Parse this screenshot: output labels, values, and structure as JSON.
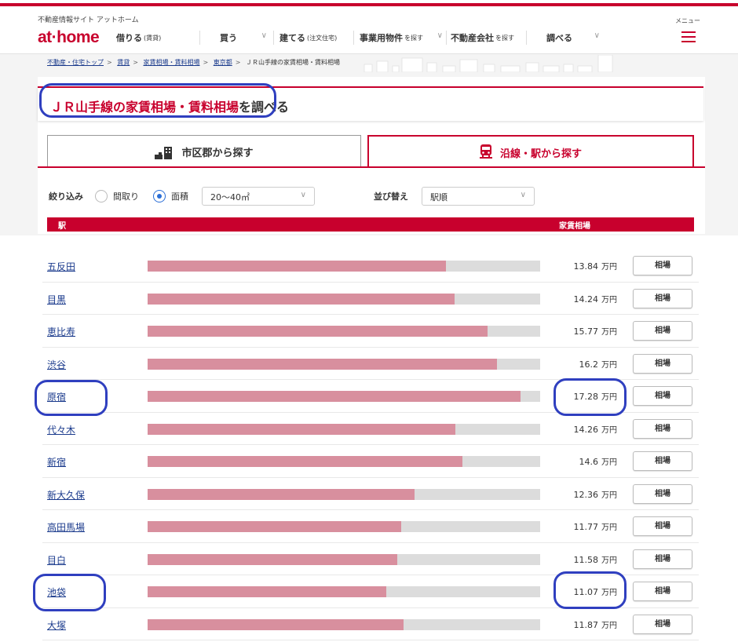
{
  "header": {
    "site_name": "不動産情報サイト アットホーム",
    "logo": "at·home",
    "menu_label": "メニュー",
    "nav": [
      {
        "label": "借りる",
        "sub": "(賃貸)",
        "chevron": ""
      },
      {
        "label": "買う",
        "sub": "",
        "chevron": "∨"
      },
      {
        "label": "建てる",
        "sub": "(注文住宅)",
        "chevron": ""
      },
      {
        "label": "事業用物件",
        "sub": "を探す",
        "chevron": "∨"
      },
      {
        "label": "不動産会社",
        "sub": "を探す",
        "chevron": ""
      },
      {
        "label": "調べる",
        "sub": "",
        "chevron": "∨"
      }
    ]
  },
  "breadcrumb": {
    "items": [
      "不動産・住宅トップ",
      "賃貸",
      "家賃相場・賃料相場",
      "東京都"
    ],
    "current": "ＪＲ山手線の家賃相場・賃料相場",
    "separator": ">"
  },
  "page": {
    "title_highlight": "ＪＲ山手線の家賃相場・賃料相場",
    "title_rest": "を調べる"
  },
  "tabs": [
    {
      "label": "市区郡から探す",
      "active": false
    },
    {
      "label": "沿線・駅から探す",
      "active": true
    }
  ],
  "filter": {
    "narrow_label": "絞り込み",
    "option_layout": "間取り",
    "option_area": "面積",
    "area_value": "20〜40㎡",
    "sort_label": "並び替え",
    "sort_value": "駅順",
    "chevron": "∨"
  },
  "table": {
    "col_station": "駅",
    "col_rent": "家賃相場",
    "button_label": "相場",
    "unit": "万円",
    "bar_max": 18.2,
    "rows": [
      {
        "station": "五反田",
        "rent": "13.84",
        "value": 13.84
      },
      {
        "station": "目黒",
        "rent": "14.24",
        "value": 14.24
      },
      {
        "station": "恵比寿",
        "rent": "15.77",
        "value": 15.77
      },
      {
        "station": "渋谷",
        "rent": "16.2",
        "value": 16.2
      },
      {
        "station": "原宿",
        "rent": "17.28",
        "value": 17.28
      },
      {
        "station": "代々木",
        "rent": "14.26",
        "value": 14.26
      },
      {
        "station": "新宿",
        "rent": "14.6",
        "value": 14.6
      },
      {
        "station": "新大久保",
        "rent": "12.36",
        "value": 12.36
      },
      {
        "station": "高田馬場",
        "rent": "11.77",
        "value": 11.77
      },
      {
        "station": "目白",
        "rent": "11.58",
        "value": 11.58
      },
      {
        "station": "池袋",
        "rent": "11.07",
        "value": 11.07
      },
      {
        "station": "大塚",
        "rent": "11.87",
        "value": 11.87
      }
    ]
  },
  "colors": {
    "brand": "#c8002d",
    "bar_fill": "#d88f9e",
    "bar_track": "#dcdcdc",
    "link": "#1a3a8c",
    "annotation": "#2f3fbf"
  }
}
